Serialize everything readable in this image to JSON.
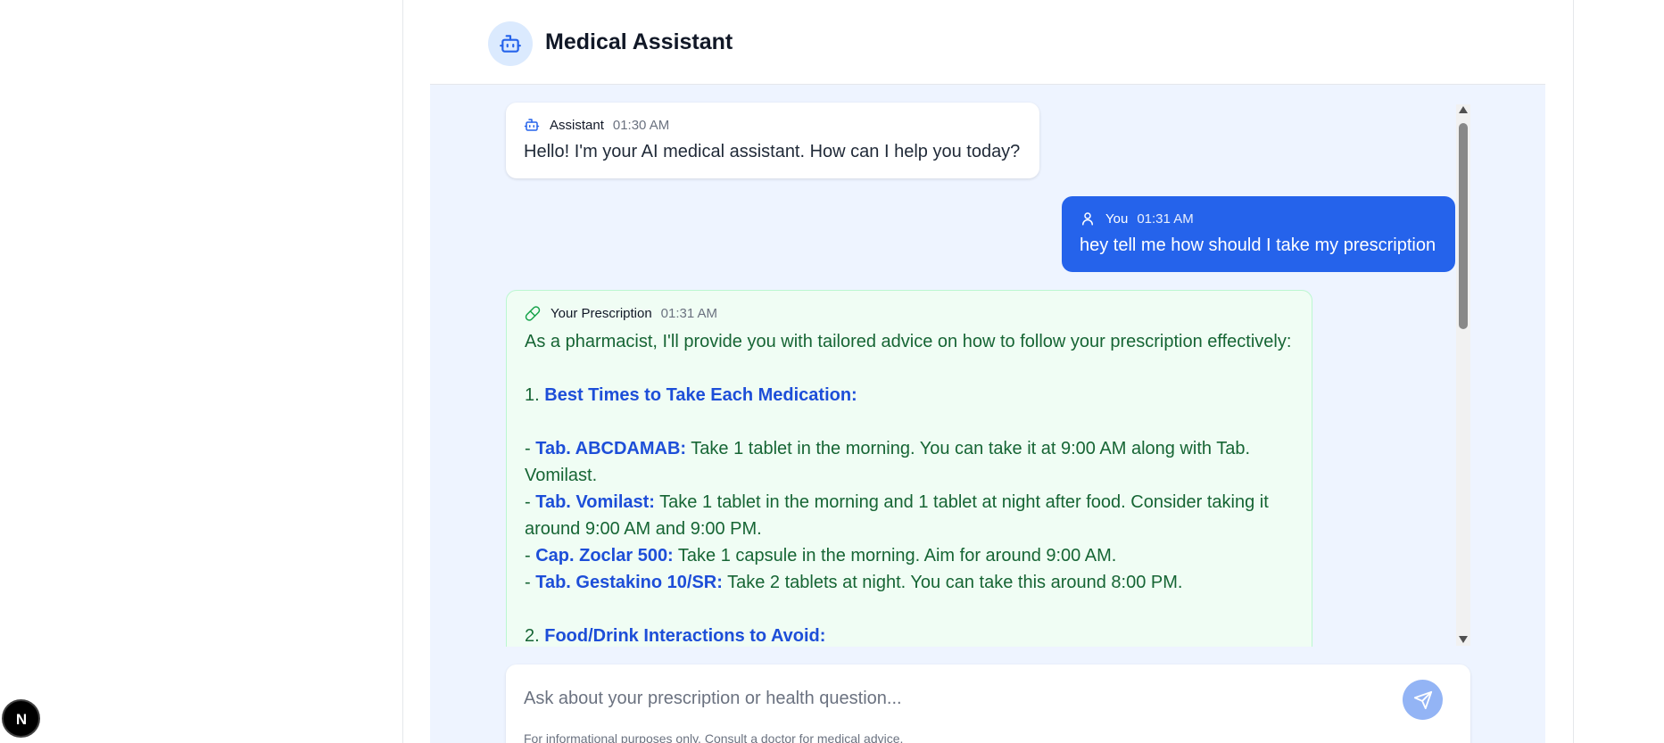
{
  "header": {
    "title": "Medical Assistant",
    "avatar_icon": "bot-icon"
  },
  "messages": [
    {
      "role": "assistant",
      "icon": "bot-icon",
      "sender": "Assistant",
      "time": "01:30 AM",
      "text": "Hello! I'm your AI medical assistant. How can I help you today?"
    },
    {
      "role": "user",
      "icon": "user-icon",
      "sender": "You",
      "time": "01:31 AM",
      "text": "hey tell me how should I take my prescription"
    },
    {
      "role": "prescription",
      "icon": "pill-icon",
      "sender": "Your Prescription",
      "time": "01:31 AM",
      "intro": "As a pharmacist, I'll provide you with tailored advice on how to follow your prescription effectively:",
      "section1_num": "1. ",
      "section1_title": "Best Times to Take Each Medication:",
      "items": [
        {
          "prefix": "- ",
          "name": "Tab. ABCDAMAB:",
          "text": " Take 1 tablet in the morning. You can take it at 9:00 AM along with Tab.",
          "cont": "Vomilast."
        },
        {
          "prefix": "- ",
          "name": "Tab. Vomilast:",
          "text": " Take 1 tablet in the morning and 1 tablet at night after food. Consider taking it",
          "cont": "around 9:00 AM and 9:00 PM."
        },
        {
          "prefix": "- ",
          "name": "Cap. Zoclar 500:",
          "text": " Take 1 capsule in the morning. Aim for around 9:00 AM."
        },
        {
          "prefix": "- ",
          "name": "Tab. Gestakino 10/SR:",
          "text": " Take 2 tablets at night. You can take this around 8:00 PM."
        }
      ],
      "section2_num": "2. ",
      "section2_title": "Food/Drink Interactions to Avoid:"
    }
  ],
  "composer": {
    "placeholder": "Ask about your prescription or health question...",
    "value": "",
    "send_icon": "send-icon",
    "disclaimer": "For informational purposes only. Consult a doctor for medical advice."
  },
  "dev_badge": {
    "label": "N"
  },
  "colors": {
    "accent": "#2563eb",
    "prescription_bg": "#f0fdf4",
    "prescription_text": "#166534",
    "highlight": "#1d4ed8",
    "chat_bg": "#eef4ff"
  }
}
